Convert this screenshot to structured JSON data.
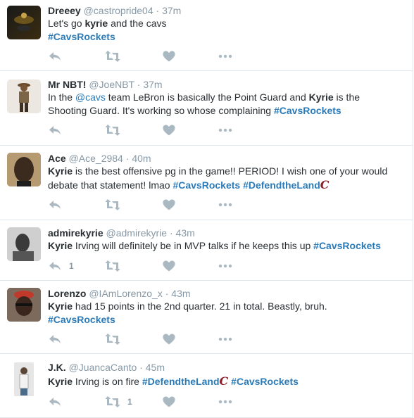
{
  "tweets": [
    {
      "name": "Dreeey",
      "handle": "@castropride04",
      "time": "37m",
      "line1": "Let's go ",
      "line1_bold": "kyrie",
      "line1_rest": " and the cavs",
      "tag": "#CavsRockets"
    },
    {
      "name": "Mr NBT!",
      "handle": "@JoeNBT",
      "time": "37m",
      "p1": "In the ",
      "mention": "@cavs",
      "p2": " team LeBron is basically the Point Guard and ",
      "bold": "Kyrie",
      "p3": " is the",
      "line2": "Shooting Guard. It's working so whose complaining ",
      "tag": "#CavsRockets"
    },
    {
      "name": "Ace",
      "handle": "@Ace_2984",
      "time": "40m",
      "bold": "Kyrie",
      "p1": " is the best offensive pg in the game!! PERIOD! I wish one of your would",
      "line2": "debate that statement! lmao ",
      "tag1": "#CavsRockets",
      "tag2": "#DefendtheLand",
      "emoji": "C"
    },
    {
      "name": "admirekyrie",
      "handle": "@admirekyrie",
      "time": "43m",
      "bold": "Kyrie",
      "p1": " Irving will definitely be in MVP talks if he keeps this up ",
      "tag": "#CavsRockets",
      "reply_count": "1"
    },
    {
      "name": "Lorenzo",
      "handle": "@IAmLorenzo_x",
      "time": "43m",
      "bold": "Kyrie",
      "p1": " had 15 points in the 2nd quarter. 21 in total. Beastly, bruh.",
      "tag": "#CavsRockets"
    },
    {
      "name": "J.K.",
      "handle": "@JuancaCanto",
      "time": "45m",
      "bold": "Kyrie",
      "p1": " Irving is on fire ",
      "tag1": "#DefendtheLand",
      "emoji": "C",
      "tag2": "#CavsRockets",
      "retweet_count": "1"
    }
  ],
  "separator": " · ",
  "icons": [
    "reply-icon",
    "retweet-icon",
    "like-icon",
    "more-icon"
  ],
  "colors": {
    "link": "#2b7bb9",
    "muted": "#8899a6",
    "icon": "#aab8c2",
    "cavs": "#8b1e2d"
  }
}
